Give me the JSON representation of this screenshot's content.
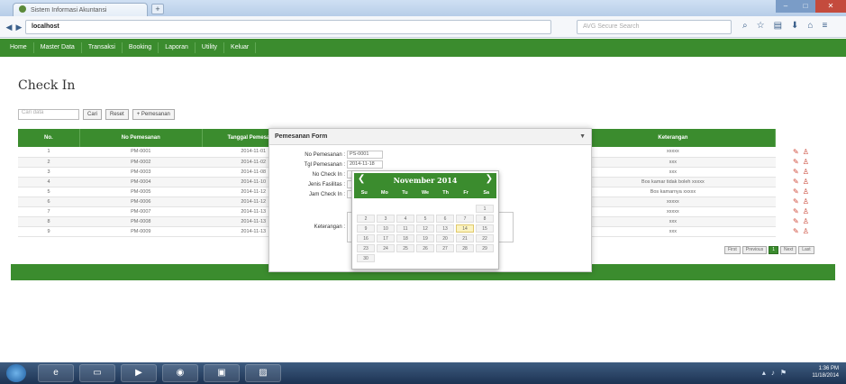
{
  "browser": {
    "tab_title": "Sistem Informasi Akuntansi",
    "url_host": "localhost",
    "search_placeholder": "AVG Secure Search"
  },
  "app_nav": [
    "Home",
    "Master Data",
    "Transaksi",
    "Booking",
    "Laporan",
    "Utility",
    "Keluar"
  ],
  "page_title": "Check In",
  "search": {
    "placeholder": "Cari data",
    "cari_label": "Cari",
    "reset_label": "Reset",
    "add_label": "+ Pemesanan"
  },
  "table": {
    "headers": [
      "No.",
      "No Pemesanan",
      "Tanggal Pemesanan",
      "",
      "",
      "Keterangan"
    ],
    "rows": [
      [
        "1",
        "PM-0001",
        "2014-11-01",
        "xxxxx"
      ],
      [
        "2",
        "PM-0002",
        "2014-11-02",
        "xxx"
      ],
      [
        "3",
        "PM-0003",
        "2014-11-08",
        "xxx"
      ],
      [
        "4",
        "PM-0004",
        "2014-11-10",
        "Bos kamar tidak boleh xxxxx"
      ],
      [
        "5",
        "PM-0005",
        "2014-11-12",
        "Bos kamarnya xxxxx"
      ],
      [
        "6",
        "PM-0006",
        "2014-11-12",
        "xxxxx"
      ],
      [
        "7",
        "PM-0007",
        "2014-11-13",
        "xxxxx"
      ],
      [
        "8",
        "PM-0008",
        "2014-11-13",
        "xxx"
      ],
      [
        "9",
        "PM-0009",
        "2014-11-13",
        "xxx"
      ]
    ]
  },
  "pagination": [
    "First",
    "Previous",
    "1",
    "Next",
    "Last"
  ],
  "modal": {
    "title": "Pemesanan Form",
    "close_label": "▼",
    "fields": [
      {
        "label": "No Pemesanan :",
        "value": "PS-0001"
      },
      {
        "label": "Tgl Pemesanan :",
        "value": "2014-11-18"
      },
      {
        "label": "No Check In :",
        "value": ""
      },
      {
        "label": "Jenis Fasilitas :",
        "value": ""
      },
      {
        "label": "Jam Check In :",
        "value": ""
      },
      {
        "label": "Keterangan :",
        "value": ""
      }
    ]
  },
  "datepicker": {
    "title": "November 2014",
    "prev_label": "❮",
    "next_label": "❯",
    "weekdays": [
      "Su",
      "Mo",
      "Tu",
      "We",
      "Th",
      "Fr",
      "Sa"
    ],
    "weeks": [
      [
        "",
        "",
        "",
        "",
        "",
        "",
        "1"
      ],
      [
        "2",
        "3",
        "4",
        "5",
        "6",
        "7",
        "8"
      ],
      [
        "9",
        "10",
        "11",
        "12",
        "13",
        "14",
        "15"
      ],
      [
        "16",
        "17",
        "18",
        "19",
        "20",
        "21",
        "22"
      ],
      [
        "23",
        "24",
        "25",
        "26",
        "27",
        "28",
        "29"
      ],
      [
        "30",
        "",
        "",
        "",
        "",
        "",
        ""
      ]
    ],
    "today": "14"
  },
  "taskbar": {
    "time": "1:36 PM",
    "date": "11/18/2014"
  }
}
